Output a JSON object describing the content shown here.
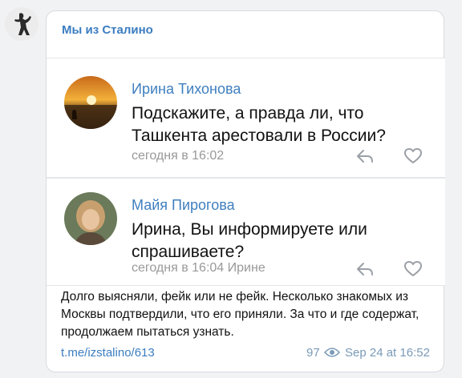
{
  "channel": {
    "name": "Мы из Сталино",
    "avatar_icon": "statue-silhouette-icon"
  },
  "comments": [
    {
      "author": "Ирина Тихонова",
      "text": "Подскажите, а правда ли, что Ташкента арестовали в России?",
      "meta": "сегодня в 16:02",
      "avatar": "sunset-sea-avatar"
    },
    {
      "author": "Майя Пирогова",
      "text": "Ирина,  Вы информируете или спрашиваете?",
      "meta": "сегодня в 16:04 Ирине",
      "avatar": "woman-portrait-avatar"
    }
  ],
  "post": {
    "text": "Долго выясняли, фейк или не фейк. Несколько знакомых из Москвы подтвердили, что его приняли. За что и где содержат, продолжаем пытаться узнать.",
    "link": "t.me/izstalino/613",
    "views": "97",
    "date": "Sep 24 at 16:52"
  },
  "colors": {
    "accent": "#3b7dc0",
    "author": "#3f7fbf",
    "meta": "#999999"
  }
}
